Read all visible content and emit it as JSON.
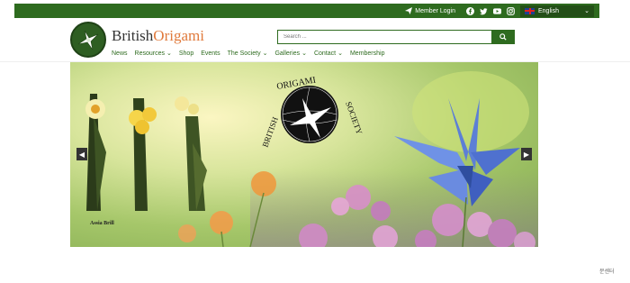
{
  "topbar": {
    "member_login": "Member Login",
    "language": "English",
    "social_icons": [
      "facebook-icon",
      "twitter-icon",
      "youtube-icon",
      "instagram-icon"
    ]
  },
  "header": {
    "brand_part1": "British",
    "brand_part2": "Origami",
    "search_placeholder": "Search ...",
    "nav": [
      {
        "label": "News",
        "dropdown": false
      },
      {
        "label": "Resources",
        "dropdown": true
      },
      {
        "label": "Shop",
        "dropdown": false
      },
      {
        "label": "Events",
        "dropdown": false
      },
      {
        "label": "The Society",
        "dropdown": true
      },
      {
        "label": "Galleries",
        "dropdown": true
      },
      {
        "label": "Contact",
        "dropdown": true
      },
      {
        "label": "Membership",
        "dropdown": false
      }
    ]
  },
  "hero": {
    "caption": "Assia Brill",
    "emblem_text": "BRITISH ORIGAMI SOCIETY"
  },
  "footer_corner": "문센터",
  "colors": {
    "primary_green": "#2e6b1f",
    "brand_orange": "#e07a3c"
  }
}
